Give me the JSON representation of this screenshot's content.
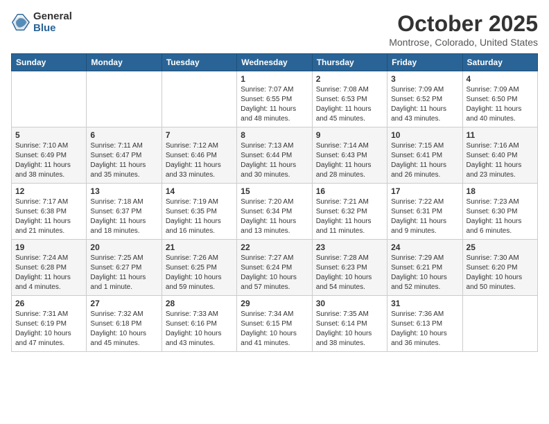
{
  "logo": {
    "general": "General",
    "blue": "Blue"
  },
  "header": {
    "month": "October 2025",
    "location": "Montrose, Colorado, United States"
  },
  "weekdays": [
    "Sunday",
    "Monday",
    "Tuesday",
    "Wednesday",
    "Thursday",
    "Friday",
    "Saturday"
  ],
  "weeks": [
    [
      {
        "day": "",
        "info": ""
      },
      {
        "day": "",
        "info": ""
      },
      {
        "day": "",
        "info": ""
      },
      {
        "day": "1",
        "info": "Sunrise: 7:07 AM\nSunset: 6:55 PM\nDaylight: 11 hours\nand 48 minutes."
      },
      {
        "day": "2",
        "info": "Sunrise: 7:08 AM\nSunset: 6:53 PM\nDaylight: 11 hours\nand 45 minutes."
      },
      {
        "day": "3",
        "info": "Sunrise: 7:09 AM\nSunset: 6:52 PM\nDaylight: 11 hours\nand 43 minutes."
      },
      {
        "day": "4",
        "info": "Sunrise: 7:09 AM\nSunset: 6:50 PM\nDaylight: 11 hours\nand 40 minutes."
      }
    ],
    [
      {
        "day": "5",
        "info": "Sunrise: 7:10 AM\nSunset: 6:49 PM\nDaylight: 11 hours\nand 38 minutes."
      },
      {
        "day": "6",
        "info": "Sunrise: 7:11 AM\nSunset: 6:47 PM\nDaylight: 11 hours\nand 35 minutes."
      },
      {
        "day": "7",
        "info": "Sunrise: 7:12 AM\nSunset: 6:46 PM\nDaylight: 11 hours\nand 33 minutes."
      },
      {
        "day": "8",
        "info": "Sunrise: 7:13 AM\nSunset: 6:44 PM\nDaylight: 11 hours\nand 30 minutes."
      },
      {
        "day": "9",
        "info": "Sunrise: 7:14 AM\nSunset: 6:43 PM\nDaylight: 11 hours\nand 28 minutes."
      },
      {
        "day": "10",
        "info": "Sunrise: 7:15 AM\nSunset: 6:41 PM\nDaylight: 11 hours\nand 26 minutes."
      },
      {
        "day": "11",
        "info": "Sunrise: 7:16 AM\nSunset: 6:40 PM\nDaylight: 11 hours\nand 23 minutes."
      }
    ],
    [
      {
        "day": "12",
        "info": "Sunrise: 7:17 AM\nSunset: 6:38 PM\nDaylight: 11 hours\nand 21 minutes."
      },
      {
        "day": "13",
        "info": "Sunrise: 7:18 AM\nSunset: 6:37 PM\nDaylight: 11 hours\nand 18 minutes."
      },
      {
        "day": "14",
        "info": "Sunrise: 7:19 AM\nSunset: 6:35 PM\nDaylight: 11 hours\nand 16 minutes."
      },
      {
        "day": "15",
        "info": "Sunrise: 7:20 AM\nSunset: 6:34 PM\nDaylight: 11 hours\nand 13 minutes."
      },
      {
        "day": "16",
        "info": "Sunrise: 7:21 AM\nSunset: 6:32 PM\nDaylight: 11 hours\nand 11 minutes."
      },
      {
        "day": "17",
        "info": "Sunrise: 7:22 AM\nSunset: 6:31 PM\nDaylight: 11 hours\nand 9 minutes."
      },
      {
        "day": "18",
        "info": "Sunrise: 7:23 AM\nSunset: 6:30 PM\nDaylight: 11 hours\nand 6 minutes."
      }
    ],
    [
      {
        "day": "19",
        "info": "Sunrise: 7:24 AM\nSunset: 6:28 PM\nDaylight: 11 hours\nand 4 minutes."
      },
      {
        "day": "20",
        "info": "Sunrise: 7:25 AM\nSunset: 6:27 PM\nDaylight: 11 hours\nand 1 minute."
      },
      {
        "day": "21",
        "info": "Sunrise: 7:26 AM\nSunset: 6:25 PM\nDaylight: 10 hours\nand 59 minutes."
      },
      {
        "day": "22",
        "info": "Sunrise: 7:27 AM\nSunset: 6:24 PM\nDaylight: 10 hours\nand 57 minutes."
      },
      {
        "day": "23",
        "info": "Sunrise: 7:28 AM\nSunset: 6:23 PM\nDaylight: 10 hours\nand 54 minutes."
      },
      {
        "day": "24",
        "info": "Sunrise: 7:29 AM\nSunset: 6:21 PM\nDaylight: 10 hours\nand 52 minutes."
      },
      {
        "day": "25",
        "info": "Sunrise: 7:30 AM\nSunset: 6:20 PM\nDaylight: 10 hours\nand 50 minutes."
      }
    ],
    [
      {
        "day": "26",
        "info": "Sunrise: 7:31 AM\nSunset: 6:19 PM\nDaylight: 10 hours\nand 47 minutes."
      },
      {
        "day": "27",
        "info": "Sunrise: 7:32 AM\nSunset: 6:18 PM\nDaylight: 10 hours\nand 45 minutes."
      },
      {
        "day": "28",
        "info": "Sunrise: 7:33 AM\nSunset: 6:16 PM\nDaylight: 10 hours\nand 43 minutes."
      },
      {
        "day": "29",
        "info": "Sunrise: 7:34 AM\nSunset: 6:15 PM\nDaylight: 10 hours\nand 41 minutes."
      },
      {
        "day": "30",
        "info": "Sunrise: 7:35 AM\nSunset: 6:14 PM\nDaylight: 10 hours\nand 38 minutes."
      },
      {
        "day": "31",
        "info": "Sunrise: 7:36 AM\nSunset: 6:13 PM\nDaylight: 10 hours\nand 36 minutes."
      },
      {
        "day": "",
        "info": ""
      }
    ]
  ]
}
